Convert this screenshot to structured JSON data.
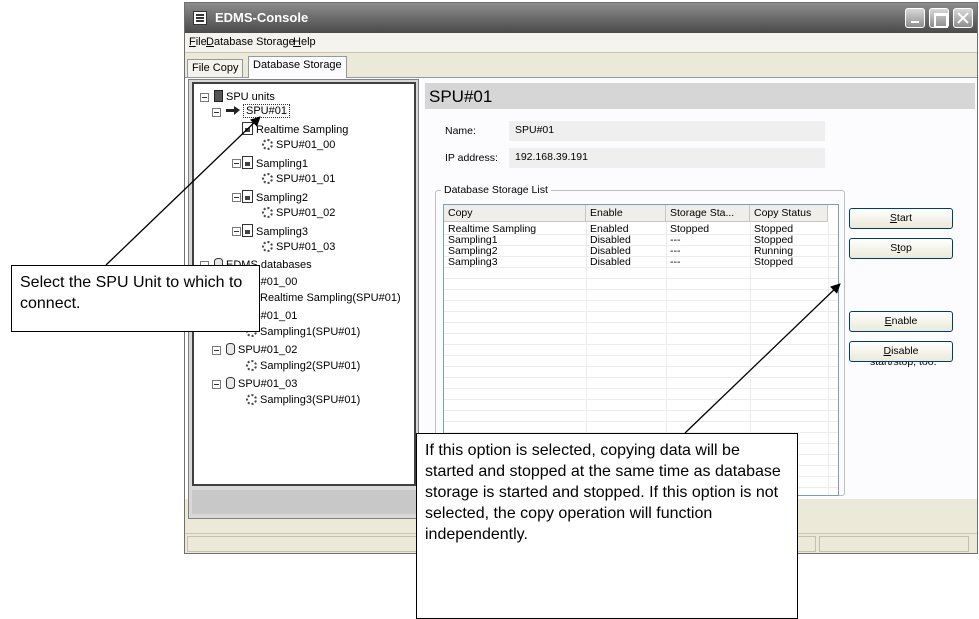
{
  "window": {
    "title": "EDMS-Console"
  },
  "menu": [
    {
      "mnemonic": "F",
      "rest": "ile"
    },
    {
      "mnemonic": "D",
      "rest": "atabase Storage"
    },
    {
      "mnemonic": "H",
      "rest": "elp"
    }
  ],
  "tabs": [
    "File Copy",
    "Database Storage"
  ],
  "active_tab": "Database Storage",
  "tree": {
    "root": "SPU units",
    "unit": "SPU#01",
    "units_children": [
      {
        "label": "Realtime Sampling",
        "child": "SPU#01_00"
      },
      {
        "label": "Sampling1",
        "child": "SPU#01_01"
      },
      {
        "label": "Sampling2",
        "child": "SPU#01_02"
      },
      {
        "label": "Sampling3",
        "child": "SPU#01_03"
      }
    ],
    "db_root": "EDMS databases",
    "databases": [
      {
        "label": "SPU#01_00",
        "child": "Realtime Sampling(SPU#01)"
      },
      {
        "label": "SPU#01_01",
        "child": "Sampling1(SPU#01)"
      },
      {
        "label": "SPU#01_02",
        "child": "Sampling2(SPU#01)"
      },
      {
        "label": "SPU#01_03",
        "child": "Sampling3(SPU#01)"
      }
    ]
  },
  "detail": {
    "title": "SPU#01",
    "name_label": "Name:",
    "name_value": "SPU#01",
    "ip_label": "IP address:",
    "ip_value": "192.168.39.191",
    "group_label": "Database Storage List",
    "columns": [
      "Copy",
      "Enable",
      "Storage Sta...",
      "Copy Status"
    ],
    "rows": [
      [
        "Realtime Sampling",
        "Enabled",
        "Stopped",
        "Stopped"
      ],
      [
        "Sampling1",
        "Disabled",
        "---",
        "Stopped"
      ],
      [
        "Sampling2",
        "Disabled",
        "---",
        "Running"
      ],
      [
        "Sampling3",
        "Disabled",
        "---",
        "Stopped"
      ]
    ]
  },
  "buttons": {
    "start": {
      "mnemonic": "S",
      "rest": "tart"
    },
    "stop": {
      "pre": "S",
      "mnemonic": "t",
      "rest": "op"
    },
    "enable": {
      "mnemonic": "E",
      "rest": "nable"
    },
    "disable": {
      "mnemonic": "D",
      "rest": "isable"
    }
  },
  "copy_option": {
    "checked": true,
    "check_glyph": "✓",
    "label": "The copy task start/stop, too."
  },
  "callouts": {
    "select": "Select the SPU Unit to which to connect.",
    "option": "If this option is selected, copying data will be started and stopped at the same time as database storage is started and stopped. If this option is not selected, the copy operation will function independently."
  }
}
